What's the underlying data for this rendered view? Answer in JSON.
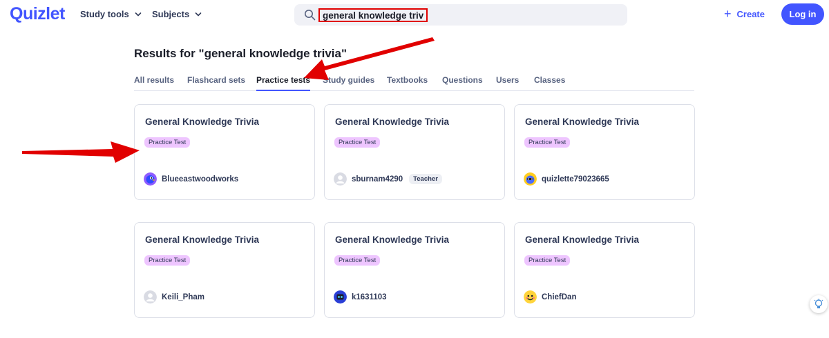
{
  "header": {
    "logo": "Quizlet",
    "nav": [
      {
        "label": "Study tools"
      },
      {
        "label": "Subjects"
      }
    ],
    "search": {
      "value": "general knowledge trivia"
    },
    "create_label": "Create",
    "login_label": "Log in"
  },
  "results_title": "Results for \"general knowledge trivia\"",
  "tabs": [
    {
      "label": "All results"
    },
    {
      "label": "Flashcard sets"
    },
    {
      "label": "Practice tests",
      "active": true
    },
    {
      "label": "Study guides"
    },
    {
      "label": "Textbooks"
    },
    {
      "label": "Questions"
    },
    {
      "label": "Users"
    },
    {
      "label": "Classes"
    }
  ],
  "cards": [
    {
      "title": "General Knowledge Trivia",
      "badge": "Practice Test",
      "author": "Blueeastwoodworks",
      "avatar": "bird-avatar-icon"
    },
    {
      "title": "General Knowledge Trivia",
      "badge": "Practice Test",
      "author": "sburnam4290",
      "role": "Teacher",
      "avatar": "default-avatar-icon"
    },
    {
      "title": "General Knowledge Trivia",
      "badge": "Practice Test",
      "author": "quizlette79023665",
      "avatar": "mascot-avatar-icon"
    },
    {
      "title": "General Knowledge Trivia",
      "badge": "Practice Test",
      "author": "Keili_Pham",
      "avatar": "default-avatar-icon"
    },
    {
      "title": "General Knowledge Trivia",
      "badge": "Practice Test",
      "author": "k1631103",
      "avatar": "robot-avatar-icon"
    },
    {
      "title": "General Knowledge Trivia",
      "badge": "Practice Test",
      "author": "ChiefDan",
      "avatar": "smiley-avatar-icon"
    }
  ],
  "colors": {
    "brand": "#4255ff",
    "badge": "#eec5ff",
    "annotation": "#e10000"
  }
}
